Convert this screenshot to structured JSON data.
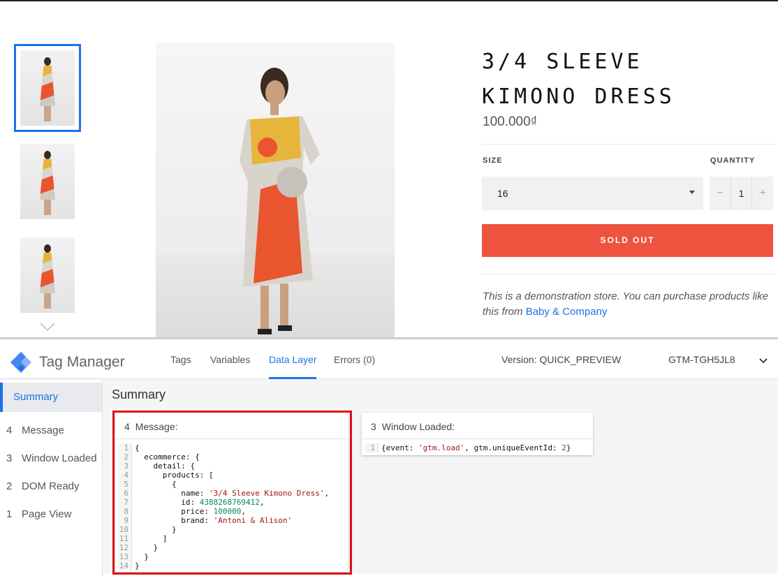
{
  "store": {
    "product_title": "3/4 Sleeve Kimono Dress",
    "price": "100.000₫",
    "size_label": "SIZE",
    "size_value": "16",
    "quantity_label": "QUANTITY",
    "quantity_minus": "−",
    "quantity_value": "1",
    "quantity_plus": "+",
    "sold_out_label": "SOLD OUT",
    "description_text": "This is a demonstration store. You can purchase products like this from",
    "description_link": "Baby & Company"
  },
  "gtm": {
    "brand": "Tag Manager",
    "tabs": [
      "Tags",
      "Variables",
      "Data Layer",
      "Errors (0)"
    ],
    "active_tab": "Data Layer",
    "version": "Version: QUICK_PREVIEW",
    "container_id": "GTM-TGH5JL8",
    "sidebar": {
      "selected": "Summary",
      "items": [
        {
          "num": "4",
          "label": "Message"
        },
        {
          "num": "3",
          "label": "Window Loaded"
        },
        {
          "num": "2",
          "label": "DOM Ready"
        },
        {
          "num": "1",
          "label": "Page View"
        }
      ]
    },
    "summary_title": "Summary",
    "cards": [
      {
        "num": "4",
        "title": "Message:"
      },
      {
        "num": "3",
        "title": "Window Loaded:"
      }
    ],
    "code_message": [
      "{",
      "  ecommerce: {",
      "    detail: {",
      "      products: [",
      "        {",
      "          name: '3/4 Sleeve Kimono Dress',",
      "          id: 4388268769412,",
      "          price: 100000,",
      "          brand: 'Antoni & Alison'",
      "        }",
      "      ]",
      "    }",
      "  }",
      "}"
    ],
    "code_window": [
      "{event: 'gtm.load', gtm.uniqueEventId: 2}"
    ]
  },
  "colors": {
    "accent": "#1a73e8",
    "sold_out": "#ee5340",
    "highlight": "#e0101a"
  }
}
